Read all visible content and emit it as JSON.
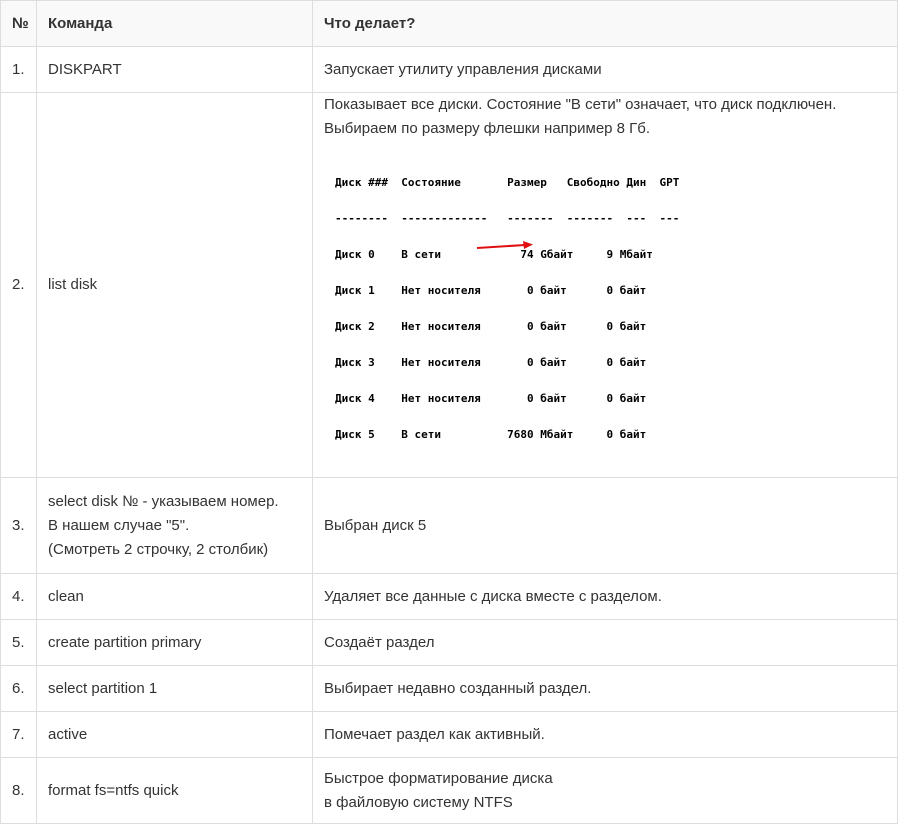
{
  "header": {
    "num": "№",
    "command": "Команда",
    "description": "Что делает?"
  },
  "rows": [
    {
      "num": "1.",
      "command": "DISKPART",
      "description": "Запускает утилиту управления дисками"
    },
    {
      "num": "2.",
      "command": "list disk",
      "description_lines": [
        "Показывает все диски. Состояние \"В сети\" означает, что диск подключен.",
        "Выбираем по размеру флешки например 8 Гб."
      ],
      "console_lines": [
        "Диск ###  Состояние       Размер   Свободно Дин  GPT",
        "--------  -------------   -------  -------  ---  ---",
        "Диск 0    В сети            74 Gбайт     9 Мбайт",
        "Диск 1    Нет носителя       0 байт      0 байт",
        "Диск 2    Нет носителя       0 байт      0 байт",
        "Диск 3    Нет носителя       0 байт      0 байт",
        "Диск 4    Нет носителя       0 байт      0 байт",
        "Диск 5    В сети          7680 Мбайт     0 байт"
      ],
      "arrow_color": "#e01010"
    },
    {
      "num": "3.",
      "command_lines": [
        "select disk № - указываем номер.",
        "В нашем случае \"5\".",
        "(Смотреть 2 строчку, 2 столбик)"
      ],
      "description": "Выбран диск 5"
    },
    {
      "num": "4.",
      "command": "clean",
      "description": "Удаляет все данные с диска вместе с разделом."
    },
    {
      "num": "5.",
      "command": "create partition primary",
      "description": "Создаёт раздел"
    },
    {
      "num": "6.",
      "command": "select partition 1",
      "description": "Выбирает недавно созданный раздел."
    },
    {
      "num": "7.",
      "command": "active",
      "description": "Помечает раздел как активный."
    },
    {
      "num": "8.",
      "command": "format fs=ntfs quick",
      "description_lines": [
        "Быстрое форматирование диска",
        "в файловую систему NTFS"
      ]
    }
  ]
}
